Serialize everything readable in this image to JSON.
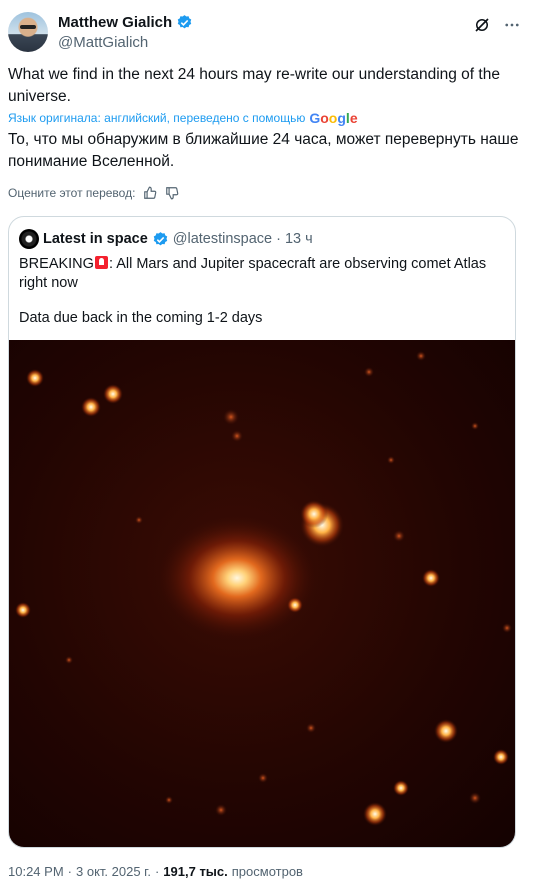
{
  "author": {
    "name": "Matthew Gialich",
    "handle": "@MattGialich"
  },
  "tweet": {
    "text": "What we find in the next 24 hours may re-write our understanding of the universe.",
    "translated_by": "Язык оригинала: английский, переведено с помощью",
    "google_letters": [
      "G",
      "o",
      "o",
      "g",
      "l",
      "e"
    ],
    "translation": "То, что мы обнаружим в ближайшие 24 часа, может перевернуть наше понимание Вселенной.",
    "rate_label": "Оцените этот перевод:"
  },
  "quote": {
    "name": "Latest in space",
    "handle": "@latestinspace",
    "dot": "·",
    "time": "13 ч",
    "text_before_emoji": "BREAKING",
    "text_after_emoji": ": All Mars and Jupiter spacecraft are observing comet Atlas right now",
    "text2": "Data due back in the coming 1-2 days",
    "image_icon": "comet-photo"
  },
  "meta": {
    "time": "10:24 PM",
    "sep1": "·",
    "date": "3 окт. 2025 г.",
    "sep2": "·",
    "views_count": "191,7 тыс.",
    "views_label": "просмотров"
  },
  "icons": {
    "verified": "verified-badge-icon",
    "grok": "grok-icon",
    "more": "more-icon",
    "thumb_up": "thumb-up-icon",
    "thumb_down": "thumb-down-icon"
  },
  "colors": {
    "accent": "#1d9bf0",
    "secondary": "#536471",
    "text": "#0f1419",
    "siren": "#f4212e"
  }
}
